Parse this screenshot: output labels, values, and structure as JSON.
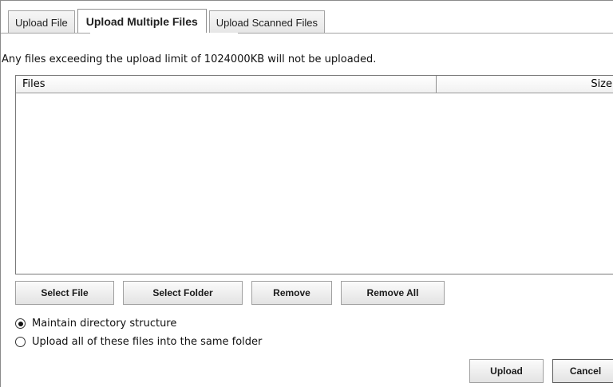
{
  "tabs": [
    {
      "label": "Upload File",
      "active": false
    },
    {
      "label": "Upload Multiple Files",
      "active": true
    },
    {
      "label": "Upload Scanned Files",
      "active": false
    }
  ],
  "notice": "Any files exceeding the upload limit of 1024000KB will not be uploaded.",
  "table": {
    "columns": [
      "Files",
      "Size"
    ],
    "rows": []
  },
  "actions": {
    "select_file": "Select File",
    "select_folder": "Select Folder",
    "remove": "Remove",
    "remove_all": "Remove All"
  },
  "options": [
    {
      "label": "Maintain directory structure",
      "checked": true
    },
    {
      "label": "Upload all of these files into the same folder",
      "checked": false
    }
  ],
  "footer": {
    "upload": "Upload",
    "cancel": "Cancel"
  }
}
